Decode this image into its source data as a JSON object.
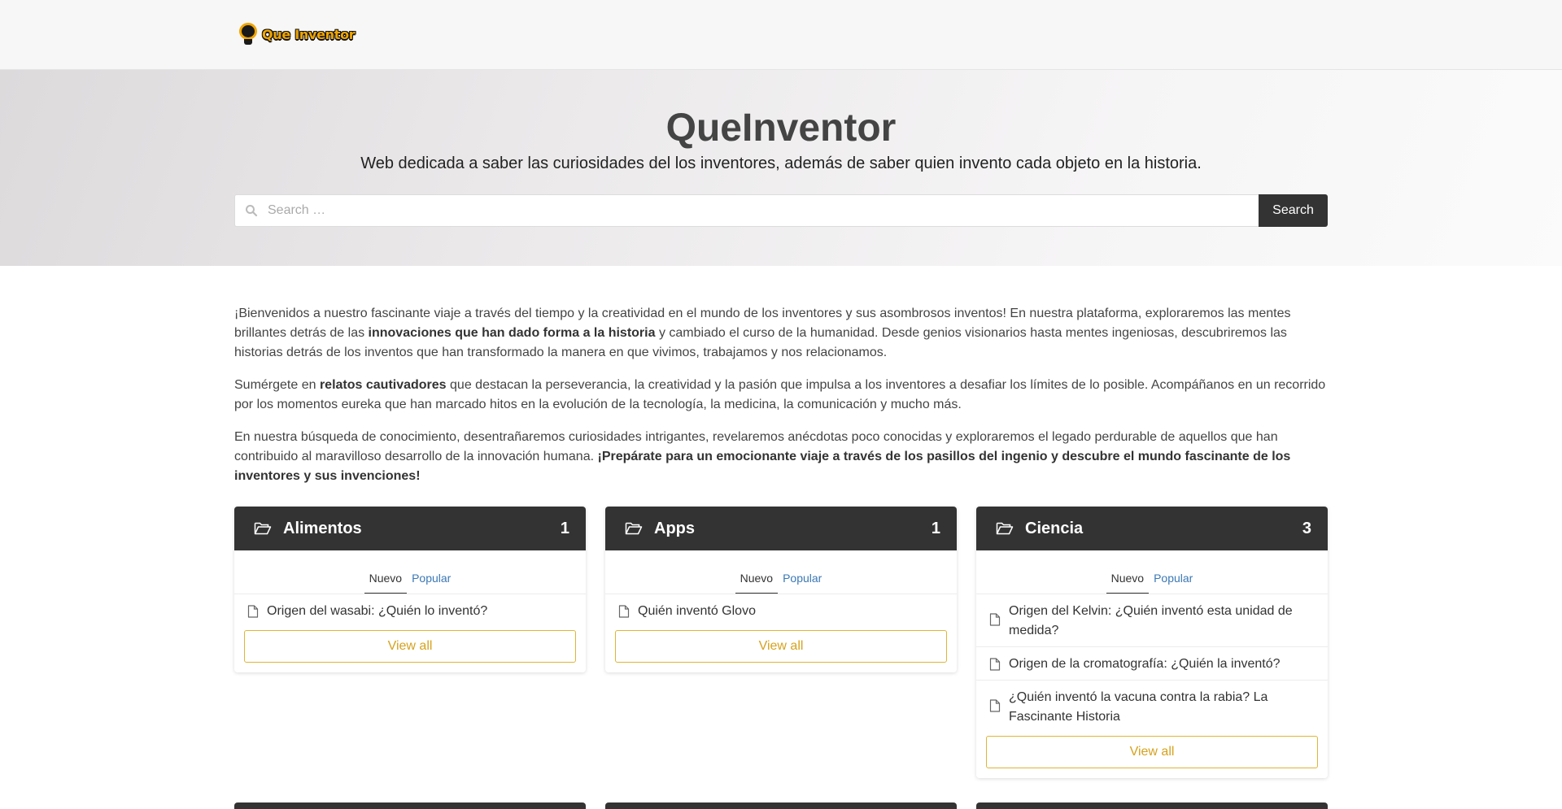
{
  "header": {
    "logo_text": "Que Inventor"
  },
  "hero": {
    "title": "QueInventor",
    "subtitle": "Web dedicada a saber las curiosidades del los inventores, además de saber quien invento cada objeto en la historia."
  },
  "search": {
    "placeholder": "Search …",
    "button_label": "Search"
  },
  "intro": {
    "p1_a": "¡Bienvenidos a nuestro fascinante viaje a través del tiempo y la creatividad en el mundo de los inventores y sus asombrosos inventos! En nuestra plataforma, exploraremos las mentes brillantes detrás de las ",
    "p1_b": "innovaciones que han dado forma a la historia",
    "p1_c": " y cambiado el curso de la humanidad. Desde genios visionarios hasta mentes ingeniosas, descubriremos las historias detrás de los inventos que han transformado la manera en que vivimos, trabajamos y nos relacionamos.",
    "p2_a": "Sumérgete en ",
    "p2_b": "relatos cautivadores",
    "p2_c": " que destacan la perseverancia, la creatividad y la pasión que impulsa a los inventores a desafiar los límites de lo posible. Acompáñanos en un recorrido por los momentos eureka que han marcado hitos en la evolución de la tecnología, la medicina, la comunicación y mucho más.",
    "p3_a": "En nuestra búsqueda de conocimiento, desentrañaremos curiosidades intrigantes, revelaremos anécdotas poco conocidas y exploraremos el legado perdurable de aquellos que han contribuido al maravilloso desarrollo de la innovación humana. ",
    "p3_b": "¡Prepárate para un emocionante viaje a través de los pasillos del ingenio y descubre el mundo fascinante de los inventores y sus invenciones!"
  },
  "categories": [
    {
      "name": "Alimentos",
      "count": "1",
      "tab_new": "Nuevo",
      "tab_popular": "Popular",
      "items": [
        "Origen del wasabi: ¿Quién lo inventó?"
      ],
      "view_all": "View all"
    },
    {
      "name": "Apps",
      "count": "1",
      "tab_new": "Nuevo",
      "tab_popular": "Popular",
      "items": [
        "Quién inventó Glovo"
      ],
      "view_all": "View all"
    },
    {
      "name": "Ciencia",
      "count": "3",
      "tab_new": "Nuevo",
      "tab_popular": "Popular",
      "items": [
        "Origen del Kelvin: ¿Quién inventó esta unidad de medida?",
        "Origen de la cromatografía: ¿Quién la inventó?",
        "¿Quién inventó la vacuna contra la rabia? La Fascinante Historia"
      ],
      "view_all": "View all"
    }
  ]
}
